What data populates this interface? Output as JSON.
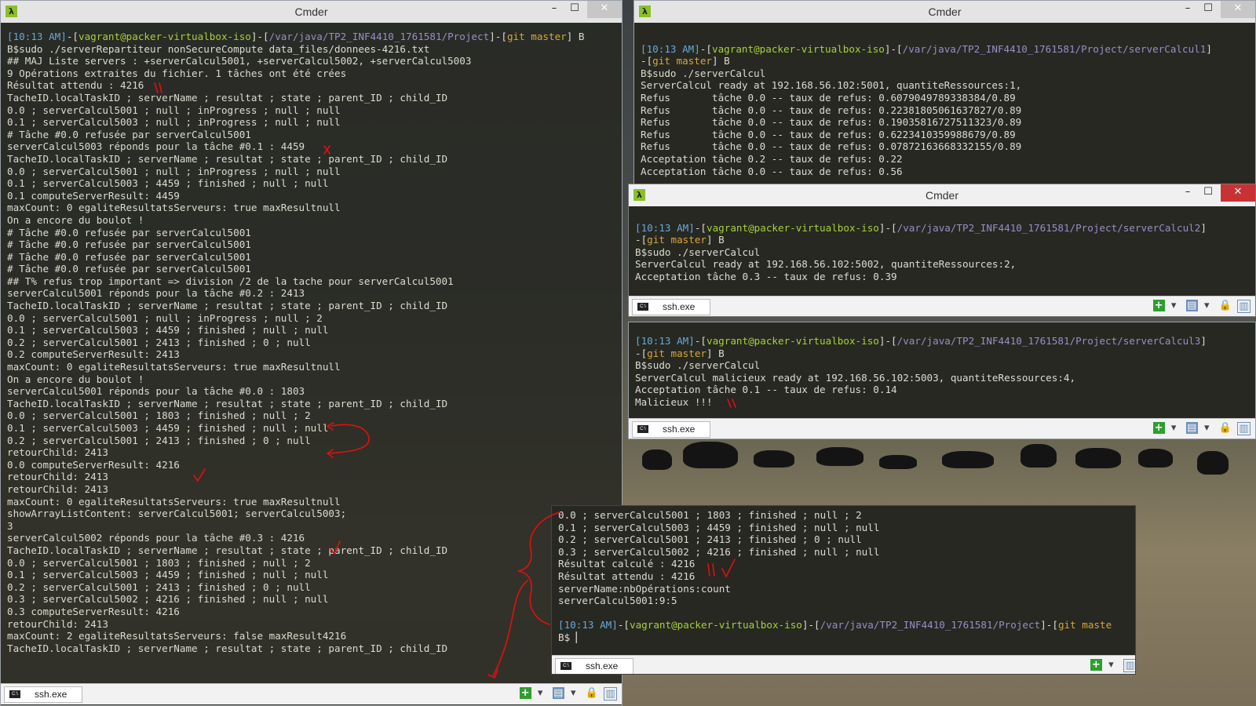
{
  "colors": {
    "terminal_bg": "#272822",
    "text": "#dcdcd0",
    "prompt_time": "#66a9d8",
    "prompt_user": "#a6d13a",
    "prompt_path": "#9b8cc7",
    "prompt_git": "#d6a63a",
    "annotation": "#e01010"
  },
  "icons": [
    "cmder-lambda-icon",
    "minimize-icon",
    "maximize-icon",
    "close-icon",
    "ssh-console-icon",
    "add-tab-icon",
    "chevron-down-icon",
    "settings-icon",
    "lock-icon",
    "layout-icon"
  ],
  "main": {
    "title": "Cmder",
    "tab": "ssh.exe",
    "lines": [
      {
        "p": [
          "[10:13 AM]",
          "-[",
          "vagrant@packer-virtualbox-iso",
          "]-[",
          "/var/java/TP2_INF4410_1761581/Project",
          "]-[",
          "git master",
          "] B"
        ]
      },
      {
        "t": "B$sudo ./serverRepartiteur nonSecureCompute data_files/donnees-4216.txt"
      },
      {
        "t": "## MAJ Liste servers : +serverCalcul5001, +serverCalcul5002, +serverCalcul5003"
      },
      {
        "t": "9 Opérations extraites du fichier. 1 tâches ont été crées"
      },
      {
        "t": "Résultat attendu : 4216"
      },
      {
        "t": "TacheID.localTaskID ; serverName ; resultat ; state ; parent_ID ; child_ID"
      },
      {
        "t": "0.0 ; serverCalcul5001 ; null ; inProgress ; null ; null"
      },
      {
        "t": "0.1 ; serverCalcul5003 ; null ; inProgress ; null ; null"
      },
      {
        "t": "# Tâche #0.0 refusée par serverCalcul5001"
      },
      {
        "t": "serverCalcul5003 réponds pour la tâche #0.1 : 4459"
      },
      {
        "t": "TacheID.localTaskID ; serverName ; resultat ; state ; parent_ID ; child_ID"
      },
      {
        "t": "0.0 ; serverCalcul5001 ; null ; inProgress ; null ; null"
      },
      {
        "t": "0.1 ; serverCalcul5003 ; 4459 ; finished ; null ; null"
      },
      {
        "t": "0.1 computeServerResult: 4459"
      },
      {
        "t": "maxCount: 0 egaliteResultatsServeurs: true maxResultnull"
      },
      {
        "t": "On a encore du boulot !"
      },
      {
        "t": "# Tâche #0.0 refusée par serverCalcul5001"
      },
      {
        "t": "# Tâche #0.0 refusée par serverCalcul5001"
      },
      {
        "t": "# Tâche #0.0 refusée par serverCalcul5001"
      },
      {
        "t": "# Tâche #0.0 refusée par serverCalcul5001"
      },
      {
        "t": "## T% refus trop important => division /2 de la tache pour serverCalcul5001"
      },
      {
        "t": "serverCalcul5001 réponds pour la tâche #0.2 : 2413"
      },
      {
        "t": "TacheID.localTaskID ; serverName ; resultat ; state ; parent_ID ; child_ID"
      },
      {
        "t": "0.0 ; serverCalcul5001 ; null ; inProgress ; null ; 2"
      },
      {
        "t": "0.1 ; serverCalcul5003 ; 4459 ; finished ; null ; null"
      },
      {
        "t": "0.2 ; serverCalcul5001 ; 2413 ; finished ; 0 ; null"
      },
      {
        "t": "0.2 computeServerResult: 2413"
      },
      {
        "t": "maxCount: 0 egaliteResultatsServeurs: true maxResultnull"
      },
      {
        "t": "On a encore du boulot !"
      },
      {
        "t": "serverCalcul5001 réponds pour la tâche #0.0 : 1803"
      },
      {
        "t": "TacheID.localTaskID ; serverName ; resultat ; state ; parent_ID ; child_ID"
      },
      {
        "t": "0.0 ; serverCalcul5001 ; 1803 ; finished ; null ; 2"
      },
      {
        "t": "0.1 ; serverCalcul5003 ; 4459 ; finished ; null ; null"
      },
      {
        "t": "0.2 ; serverCalcul5001 ; 2413 ; finished ; 0 ; null"
      },
      {
        "t": "retourChild: 2413"
      },
      {
        "t": "0.0 computeServerResult: 4216"
      },
      {
        "t": "retourChild: 2413"
      },
      {
        "t": "retourChild: 2413"
      },
      {
        "t": "maxCount: 0 egaliteResultatsServeurs: true maxResultnull"
      },
      {
        "t": "showArrayListContent: serverCalcul5001; serverCalcul5003;"
      },
      {
        "t": "3"
      },
      {
        "t": "serverCalcul5002 réponds pour la tâche #0.3 : 4216"
      },
      {
        "t": "TacheID.localTaskID ; serverName ; resultat ; state ; parent_ID ; child_ID"
      },
      {
        "t": "0.0 ; serverCalcul5001 ; 1803 ; finished ; null ; 2"
      },
      {
        "t": "0.1 ; serverCalcul5003 ; 4459 ; finished ; null ; null"
      },
      {
        "t": "0.2 ; serverCalcul5001 ; 2413 ; finished ; 0 ; null"
      },
      {
        "t": "0.3 ; serverCalcul5002 ; 4216 ; finished ; null ; null"
      },
      {
        "t": "0.3 computeServerResult: 4216"
      },
      {
        "t": "retourChild: 2413"
      },
      {
        "t": "maxCount: 2 egaliteResultatsServeurs: false maxResult4216"
      },
      {
        "t": "TacheID.localTaskID ; serverName ; resultat ; state ; parent_ID ; child_ID"
      }
    ]
  },
  "server1": {
    "title": "Cmder",
    "lines": [
      {
        "t": ""
      },
      {
        "p": [
          "[10:13 AM]",
          "-[",
          "vagrant@packer-virtualbox-iso",
          "]-[",
          "/var/java/TP2_INF4410_1761581/Project/serverCalcul1",
          "]",
          ""
        ]
      },
      {
        "p": [
          "",
          "-[",
          "",
          "",
          "",
          "",
          "git master",
          "] B"
        ]
      },
      {
        "t": "B$sudo ./serverCalcul"
      },
      {
        "t": "ServerCalcul ready at 192.168.56.102:5001, quantiteRessources:1,"
      },
      {
        "t": "Refus       tâche 0.0 -- taux de refus: 0.6079049789338384/0.89"
      },
      {
        "t": "Refus       tâche 0.0 -- taux de refus: 0.22381805061637827/0.89"
      },
      {
        "t": "Refus       tâche 0.0 -- taux de refus: 0.19035816727511323/0.89"
      },
      {
        "t": "Refus       tâche 0.0 -- taux de refus: 0.6223410359988679/0.89"
      },
      {
        "t": "Refus       tâche 0.0 -- taux de refus: 0.07872163668332155/0.89"
      },
      {
        "t": "Acceptation tâche 0.2 -- taux de refus: 0.22"
      },
      {
        "t": "Acceptation tâche 0.0 -- taux de refus: 0.56"
      }
    ]
  },
  "server2": {
    "title": "Cmder",
    "tab": "ssh.exe",
    "lines": [
      {
        "t": ""
      },
      {
        "p": [
          "[10:13 AM]",
          "-[",
          "vagrant@packer-virtualbox-iso",
          "]-[",
          "/var/java/TP2_INF4410_1761581/Project/serverCalcul2",
          "]",
          ""
        ]
      },
      {
        "p": [
          "",
          "-[",
          "",
          "",
          "",
          "",
          "git master",
          "] B"
        ]
      },
      {
        "t": "B$sudo ./serverCalcul"
      },
      {
        "t": "ServerCalcul ready at 192.168.56.102:5002, quantiteRessources:2,"
      },
      {
        "t": "Acceptation tâche 0.3 -- taux de refus: 0.39"
      }
    ]
  },
  "server3": {
    "tab": "ssh.exe",
    "lines": [
      {
        "p": [
          "[10:13 AM]",
          "-[",
          "vagrant@packer-virtualbox-iso",
          "]-[",
          "/var/java/TP2_INF4410_1761581/Project/serverCalcul3",
          "]",
          ""
        ]
      },
      {
        "p": [
          "",
          "-[",
          "",
          "",
          "",
          "",
          "git master",
          "] B"
        ]
      },
      {
        "t": "B$sudo ./serverCalcul"
      },
      {
        "t": "ServerCalcul malicieux ready at 192.168.56.102:5003, quantiteRessources:4,"
      },
      {
        "t": "Acceptation tâche 0.1 -- taux de refus: 0.14"
      },
      {
        "t": "Malicieux !!!"
      }
    ]
  },
  "result": {
    "tab": "ssh.exe",
    "lines": [
      {
        "t": "0.0 ; serverCalcul5001 ; 1803 ; finished ; null ; 2"
      },
      {
        "t": "0.1 ; serverCalcul5003 ; 4459 ; finished ; null ; null"
      },
      {
        "t": "0.2 ; serverCalcul5001 ; 2413 ; finished ; 0 ; null"
      },
      {
        "t": "0.3 ; serverCalcul5002 ; 4216 ; finished ; null ; null"
      },
      {
        "t": "Résultat calculé : 4216"
      },
      {
        "t": "Résultat attendu : 4216"
      },
      {
        "t": "serverName:nbOpérations:count"
      },
      {
        "t": "serverCalcul5001:9:5"
      },
      {
        "t": ""
      },
      {
        "p": [
          "[10:13 AM]",
          "-[",
          "vagrant@packer-virtualbox-iso",
          "]-[",
          "/var/java/TP2_INF4410_1761581/Project",
          "]-[",
          "git maste",
          ""
        ]
      },
      {
        "t": "B$ ",
        "cursor": true
      }
    ]
  }
}
